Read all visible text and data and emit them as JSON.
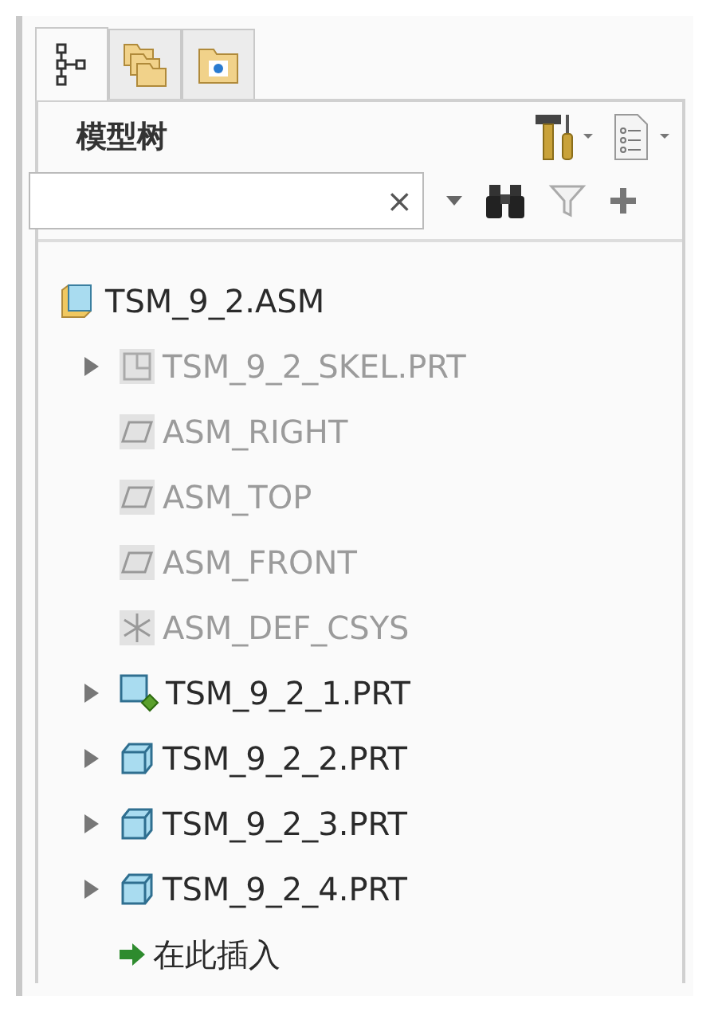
{
  "tabs": [
    {
      "kind": "tree",
      "selected": true
    },
    {
      "kind": "folders",
      "selected": false
    },
    {
      "kind": "favorites",
      "selected": false
    }
  ],
  "panel": {
    "title": "模型树",
    "search": {
      "clear": "×"
    }
  },
  "tree": {
    "label": "TSM_9_2.ASM",
    "kind": "assembly",
    "children": [
      {
        "label": "TSM_9_2_SKEL.PRT",
        "kind": "skeleton",
        "disabled": true,
        "expanded": false
      },
      {
        "label": "ASM_RIGHT",
        "kind": "plane",
        "disabled": true
      },
      {
        "label": "ASM_TOP",
        "kind": "plane",
        "disabled": true
      },
      {
        "label": "ASM_FRONT",
        "kind": "plane",
        "disabled": true
      },
      {
        "label": "ASM_DEF_CSYS",
        "kind": "csys",
        "disabled": true
      },
      {
        "label": "TSM_9_2_1.PRT",
        "kind": "part_active",
        "disabled": false,
        "expanded": false
      },
      {
        "label": "TSM_9_2_2.PRT",
        "kind": "part",
        "disabled": false,
        "expanded": false
      },
      {
        "label": "TSM_9_2_3.PRT",
        "kind": "part",
        "disabled": false,
        "expanded": false
      },
      {
        "label": "TSM_9_2_4.PRT",
        "kind": "part",
        "disabled": false,
        "expanded": false
      },
      {
        "label": "在此插入",
        "kind": "insert",
        "disabled": false
      }
    ]
  }
}
